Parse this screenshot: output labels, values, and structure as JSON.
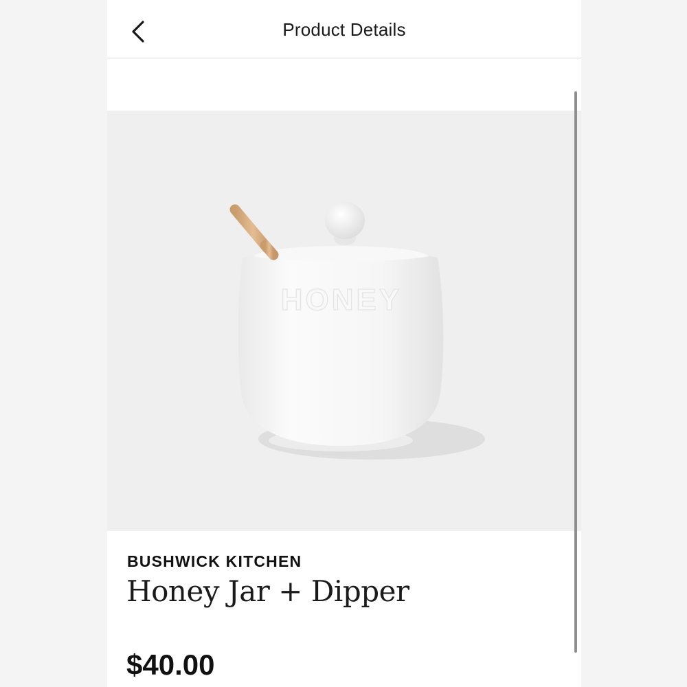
{
  "header": {
    "title": "Product Details",
    "back_icon": "chevron-left-icon"
  },
  "product": {
    "brand": "BUSHWICK KITCHEN",
    "name": "Honey Jar + Dipper",
    "price": "$40.00",
    "jar_embossed_text": "HONEY"
  },
  "colors": {
    "background": "#ffffff",
    "image_backdrop": "#efefef",
    "dipper_wood": "#d9b084",
    "jar_white": "#fafafa"
  }
}
